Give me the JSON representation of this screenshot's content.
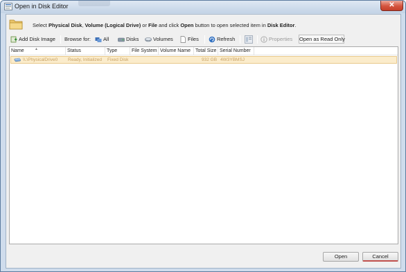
{
  "window": {
    "title": "Open in Disk Editor",
    "close_glyph": "✕",
    "icon": "disk-editor-icon"
  },
  "instruction": {
    "prefix": "Select ",
    "physical_disk": "Physical Disk",
    "comma": ", ",
    "volume": "Volume (Logical Drive)",
    "or": " or ",
    "file": "File",
    "middle": " and click ",
    "open": "Open",
    "suffix": " button to open selected item in ",
    "disk_editor": "Disk Editor",
    "end": "."
  },
  "toolbar": {
    "add_disk_image": "Add Disk Image",
    "browse_for": "Browse for:",
    "all": "All",
    "disks": "Disks",
    "volumes": "Volumes",
    "files": "Files",
    "refresh": "Refresh",
    "properties": "Properties",
    "open_read_only": "Open as Read Only"
  },
  "columns": [
    "Name",
    "Status",
    "Type",
    "File System",
    "Volume Name",
    "Total Size",
    "Serial Number"
  ],
  "rows": [
    {
      "name": "\\\\.\\PhysicalDrive0",
      "status": "Ready, Initialized",
      "type": "Fixed Disk",
      "file_system": "",
      "volume_name": "",
      "total_size": "932 GB",
      "serial_number": "4W3YBMSJ"
    }
  ],
  "buttons": {
    "open": "Open",
    "cancel": "Cancel"
  },
  "colors": {
    "selected_row_bg": "#fbeccb",
    "selected_row_text": "#c7a164",
    "close_button": "#d4553f"
  }
}
